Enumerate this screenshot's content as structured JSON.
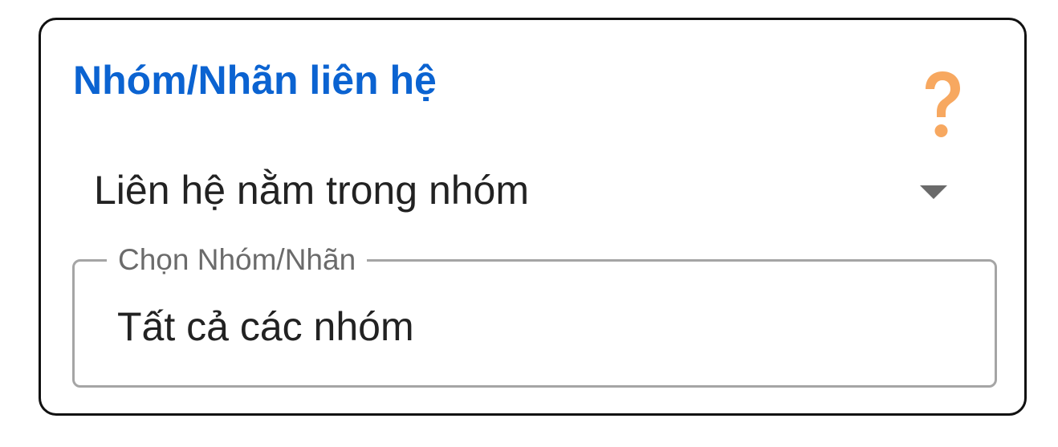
{
  "panel": {
    "title": "Nhóm/Nhãn liên hệ",
    "help_icon": "question-mark-icon",
    "help_color": "#f7a860",
    "title_color": "#0b63d1"
  },
  "condition_select": {
    "value": "Liên hệ nằm trong nhóm",
    "arrow_icon": "caret-down-icon"
  },
  "group_field": {
    "label": "Chọn Nhóm/Nhãn",
    "value": "Tất cả các nhóm"
  }
}
